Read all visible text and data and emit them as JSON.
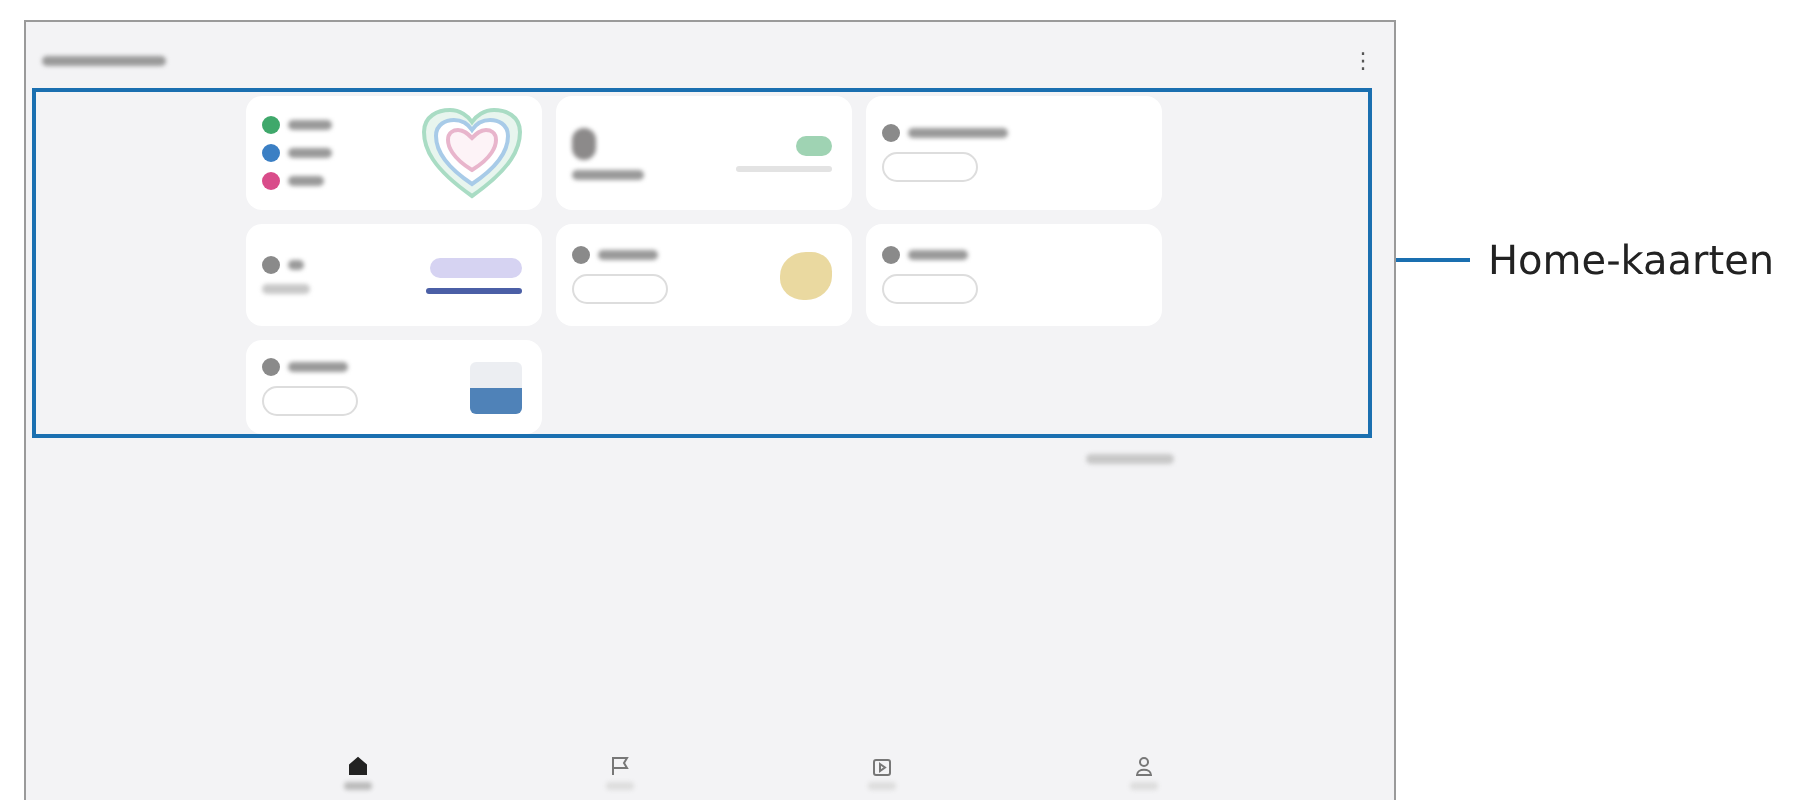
{
  "header": {
    "menu_icon": "⋮"
  },
  "cards": [
    {
      "kind": "activity"
    },
    {
      "kind": "steps"
    },
    {
      "kind": "workout"
    },
    {
      "kind": "sleep"
    },
    {
      "kind": "food"
    },
    {
      "kind": "body"
    },
    {
      "kind": "water"
    }
  ],
  "nav": {
    "tabs": [
      {
        "kind": "home",
        "selected": true
      },
      {
        "kind": "flag",
        "selected": false
      },
      {
        "kind": "video",
        "selected": false
      },
      {
        "kind": "person",
        "selected": false
      }
    ]
  },
  "callout": {
    "label": "Home-kaarten"
  }
}
